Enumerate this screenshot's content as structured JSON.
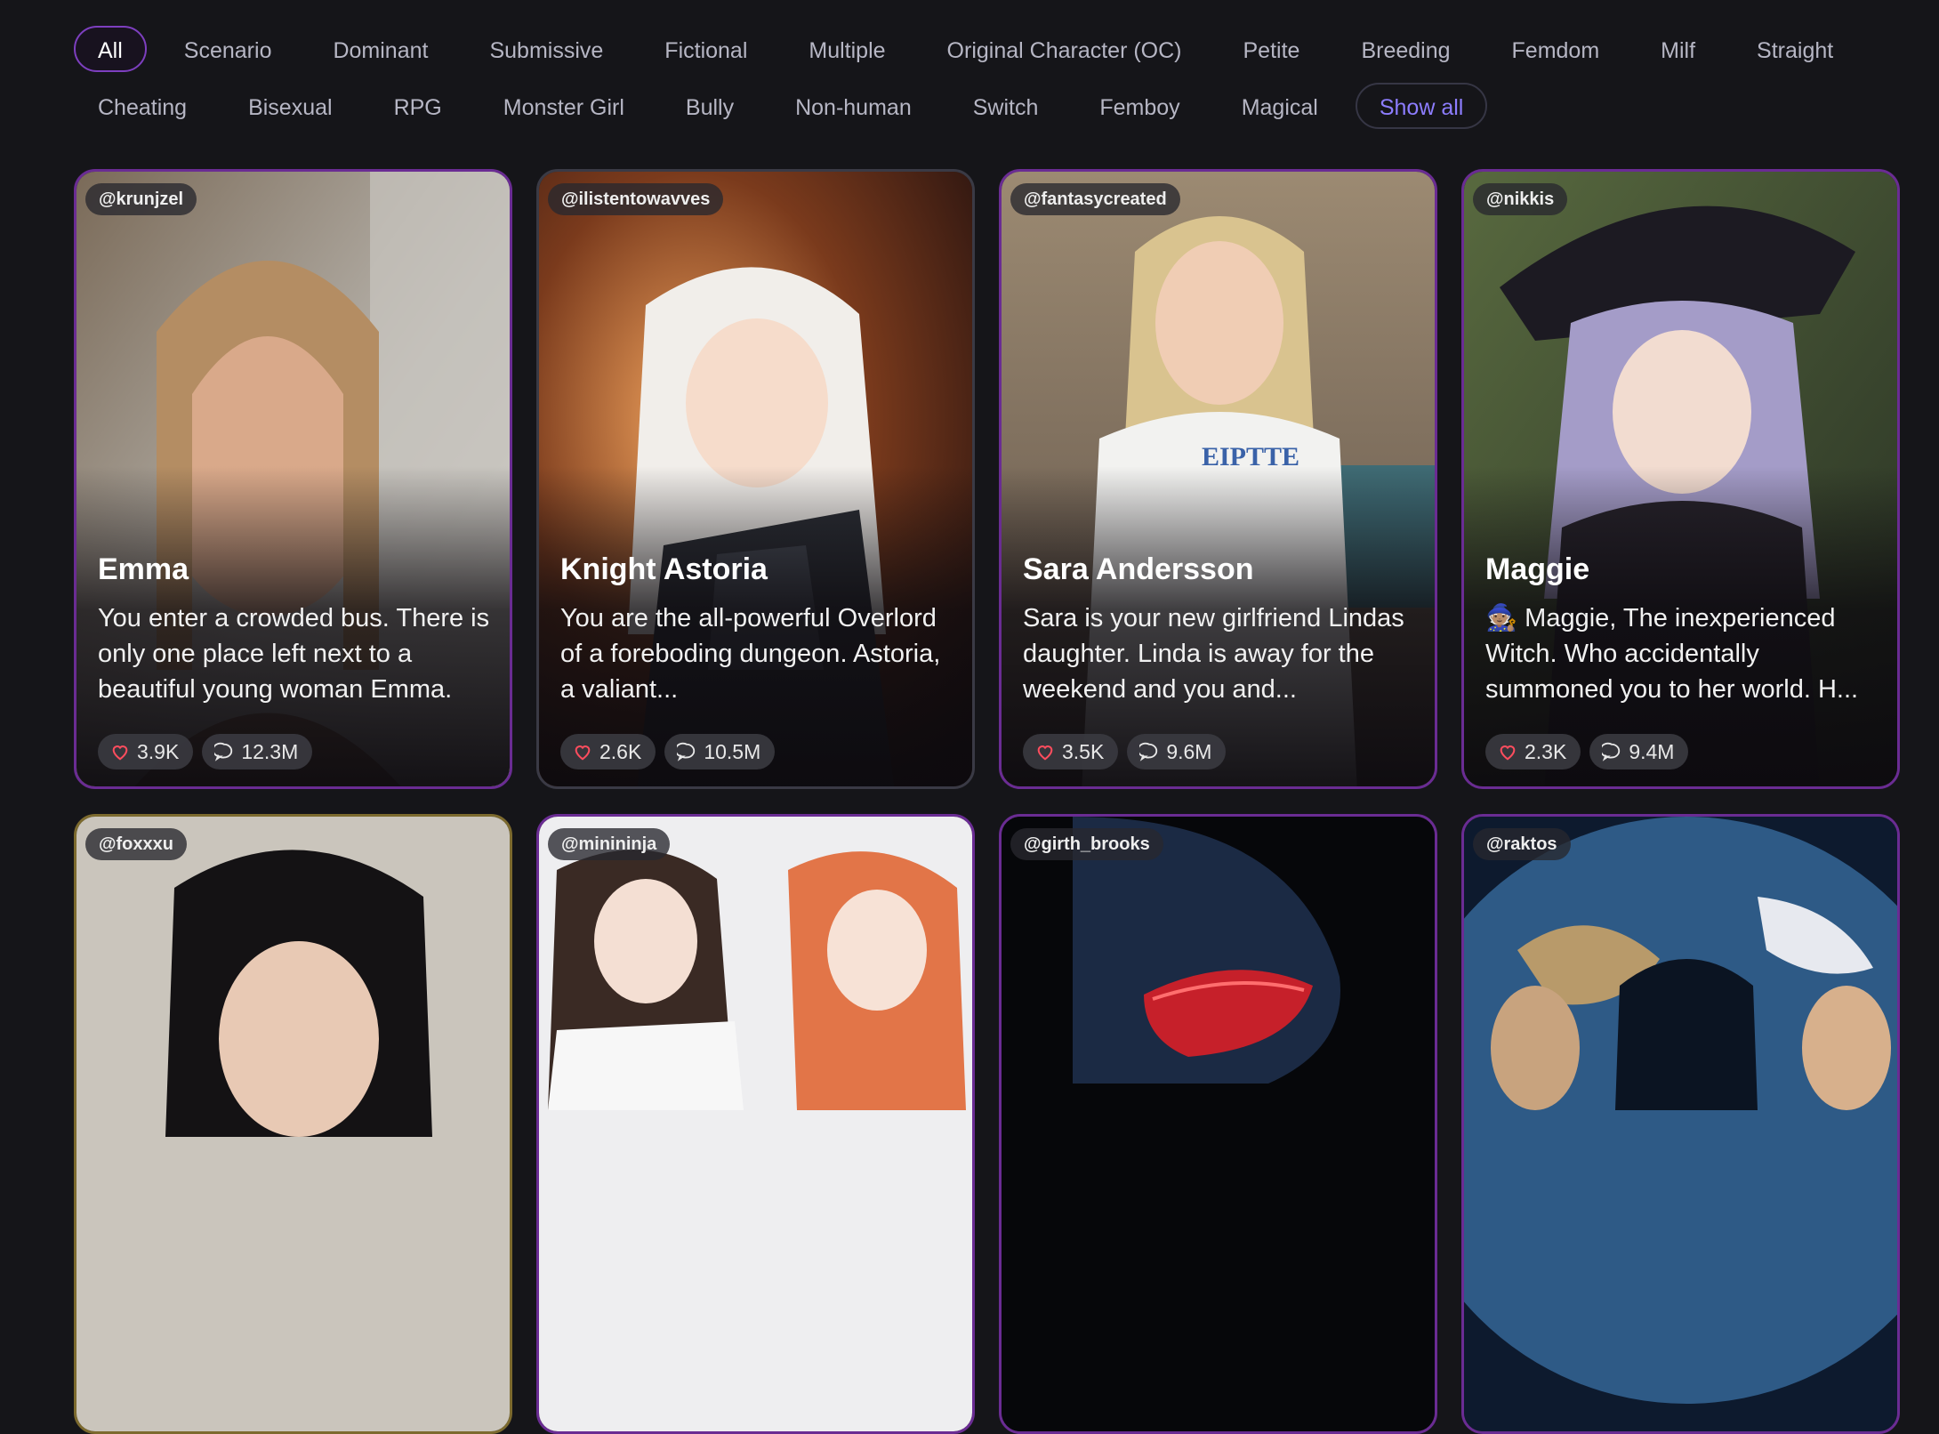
{
  "filters": {
    "row1": [
      "All",
      "Scenario",
      "Dominant",
      "Submissive",
      "Fictional",
      "Multiple",
      "Original Character (OC)",
      "Petite",
      "Breeding",
      "Femdom",
      "Milf",
      "Straight"
    ],
    "row2": [
      "Cheating",
      "Bisexual",
      "RPG",
      "Monster Girl",
      "Bully",
      "Non-human",
      "Switch",
      "Femboy",
      "Magical"
    ],
    "show_all": "Show all",
    "active": "All"
  },
  "cards": [
    {
      "handle": "@krunjzel",
      "name": "Emma",
      "desc": "You enter a crowded bus. There is only one place left next to a beautiful young woman Emma.",
      "likes": "3.9K",
      "chats": "12.3M"
    },
    {
      "handle": "@ilistentowavves",
      "name": "Knight Astoria",
      "desc": "You are the all-powerful Overlord of a foreboding dungeon. Astoria, a valiant...",
      "likes": "2.6K",
      "chats": "10.5M"
    },
    {
      "handle": "@fantasycreated",
      "name": "Sara Andersson",
      "desc": "Sara is your new girlfriend Lindas daughter. Linda is away for the weekend and you and...",
      "likes": "3.5K",
      "chats": "9.6M"
    },
    {
      "handle": "@nikkis",
      "name": "Maggie",
      "desc": "🧙🏽 Maggie, The inexperienced Witch. Who accidentally summoned you to her world. H...",
      "likes": "2.3K",
      "chats": "9.4M"
    },
    {
      "handle": "@foxxxu"
    },
    {
      "handle": "@minininja"
    },
    {
      "handle": "@girth_brooks"
    },
    {
      "handle": "@raktos"
    }
  ],
  "colors": {
    "accent": "#8d7dff",
    "active_border": "#7d3fbf",
    "background": "#151519"
  }
}
